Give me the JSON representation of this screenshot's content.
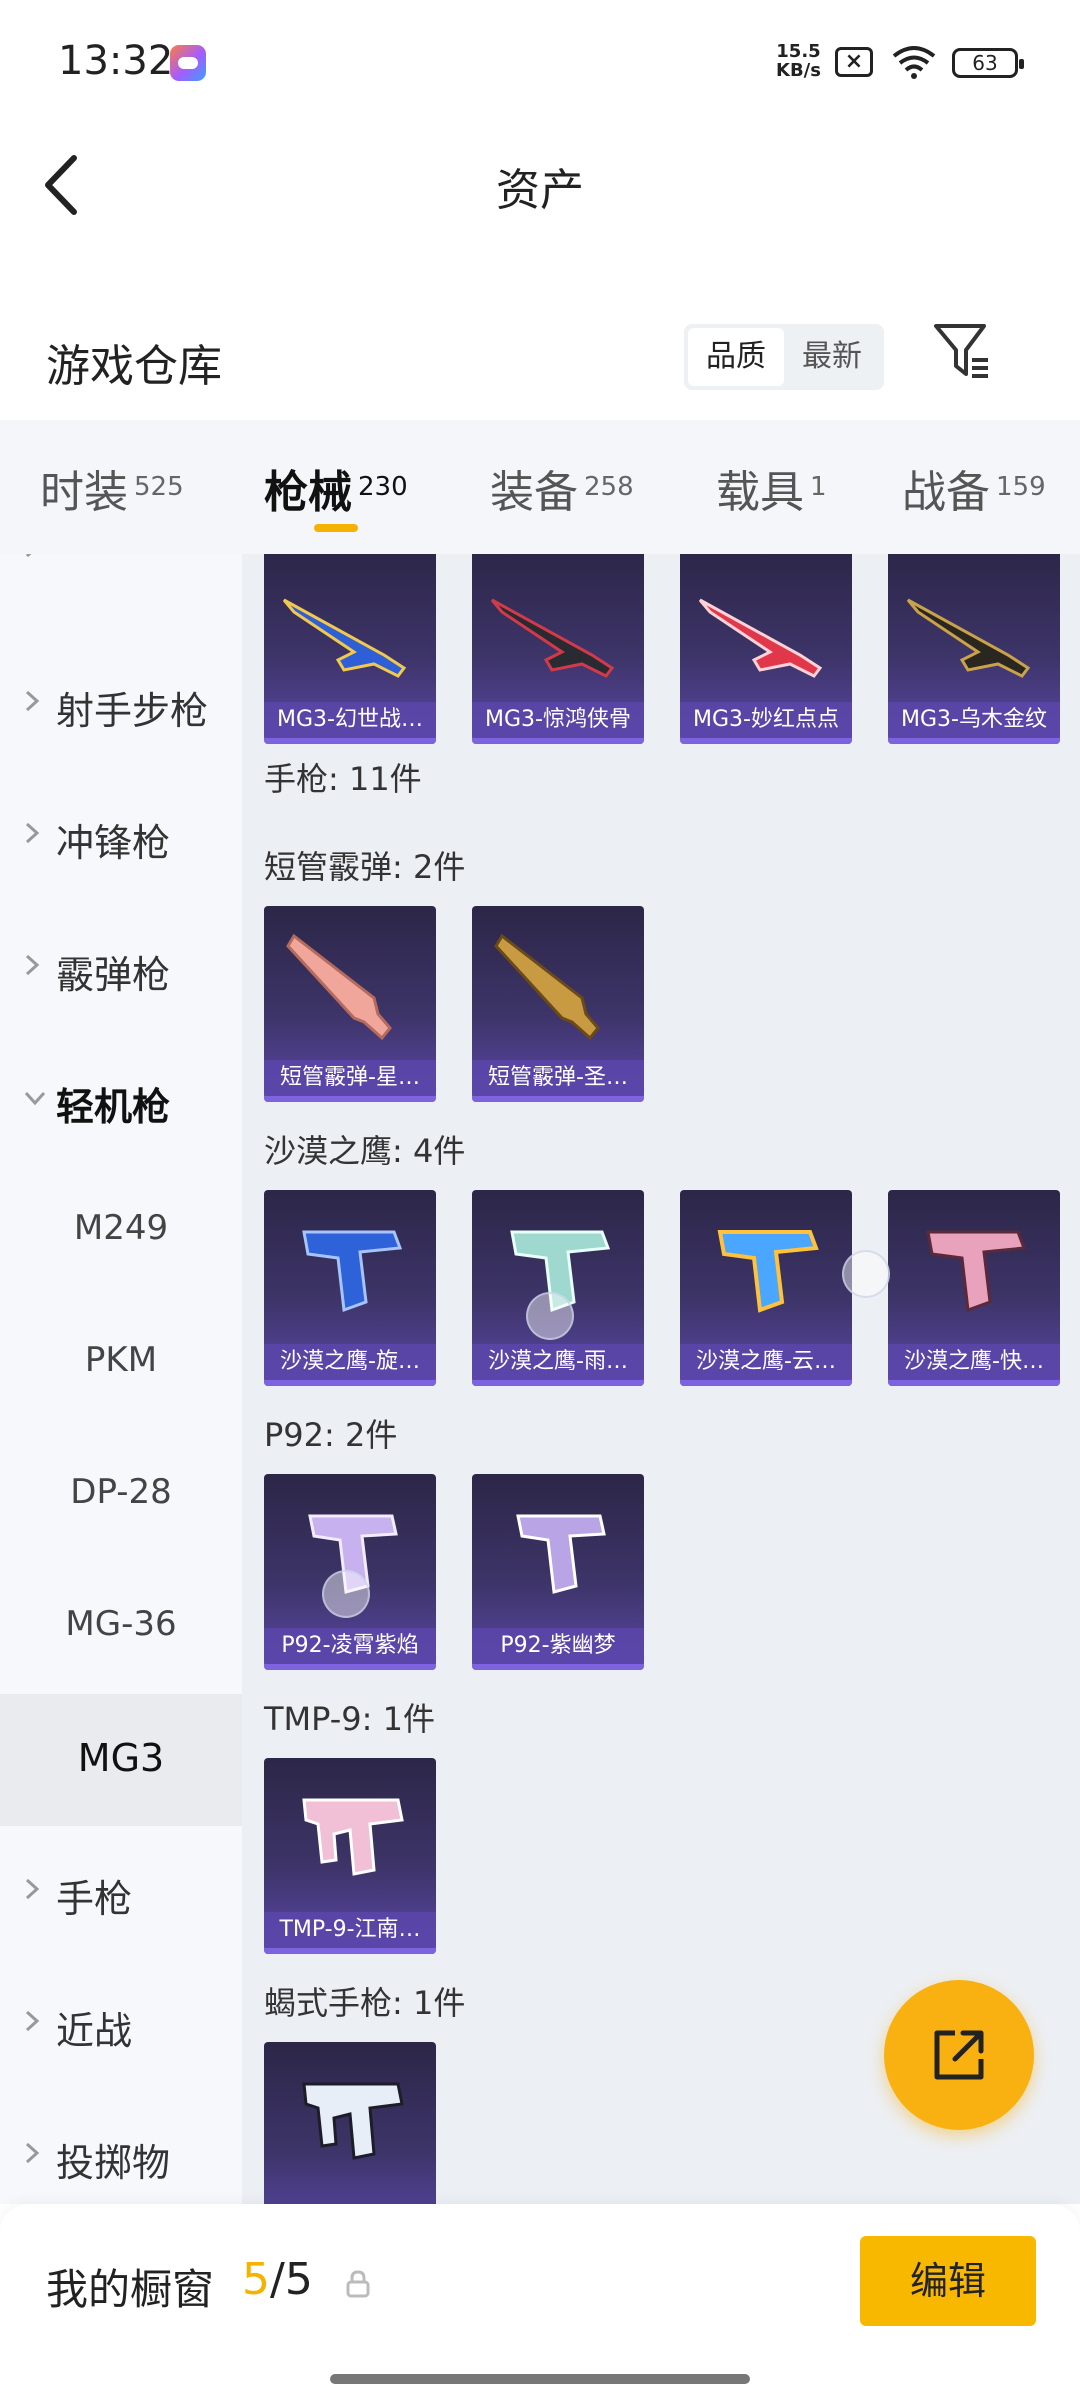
{
  "status": {
    "time": "13:32",
    "net_speed": "15.5",
    "net_unit": "KB/s",
    "battery": "63"
  },
  "header": {
    "title": "资产"
  },
  "warehouse": {
    "title": "游戏仓库",
    "sort_quality": "品质",
    "sort_newest": "最新"
  },
  "tabs": [
    {
      "label": "时装",
      "count": "525"
    },
    {
      "label": "枪械",
      "count": "230"
    },
    {
      "label": "装备",
      "count": "258"
    },
    {
      "label": "载具",
      "count": "1"
    },
    {
      "label": "战备",
      "count": "159"
    }
  ],
  "sidebar": {
    "items": [
      {
        "label": "射手步枪"
      },
      {
        "label": "冲锋枪"
      },
      {
        "label": "霰弹枪"
      },
      {
        "label": "轻机枪"
      },
      {
        "label": "M249"
      },
      {
        "label": "PKM"
      },
      {
        "label": "DP-28"
      },
      {
        "label": "MG-36"
      },
      {
        "label": "MG3"
      },
      {
        "label": "手枪"
      },
      {
        "label": "近战"
      },
      {
        "label": "投掷物"
      }
    ]
  },
  "sections": {
    "mg3_cards": [
      "MG3-幻世战…",
      "MG3-惊鸿侠骨",
      "MG3-妙红点点",
      "MG3-乌木金纹"
    ],
    "pistol": {
      "title": "手枪: 11件"
    },
    "sawed_off": {
      "title": "短管霰弹: 2件",
      "cards": [
        "短管霰弹-星…",
        "短管霰弹-圣…"
      ]
    },
    "deagle": {
      "title": "沙漠之鹰: 4件",
      "cards": [
        "沙漠之鹰-旋…",
        "沙漠之鹰-雨…",
        "沙漠之鹰-云…",
        "沙漠之鹰-快…"
      ]
    },
    "p92": {
      "title": "P92: 2件",
      "cards": [
        "P92-凌霄紫焰",
        "P92-紫幽梦"
      ]
    },
    "tmp9": {
      "title": "TMP-9: 1件",
      "cards": [
        "TMP-9-江南…"
      ]
    },
    "scorpion": {
      "title": "蝎式手枪: 1件"
    }
  },
  "bottom": {
    "window_label": "我的橱窗",
    "window_current": "5",
    "window_total": "/5",
    "edit_label": "编辑"
  },
  "colors": {
    "accent": "#f9b011",
    "card_bg": "#3d3468"
  }
}
